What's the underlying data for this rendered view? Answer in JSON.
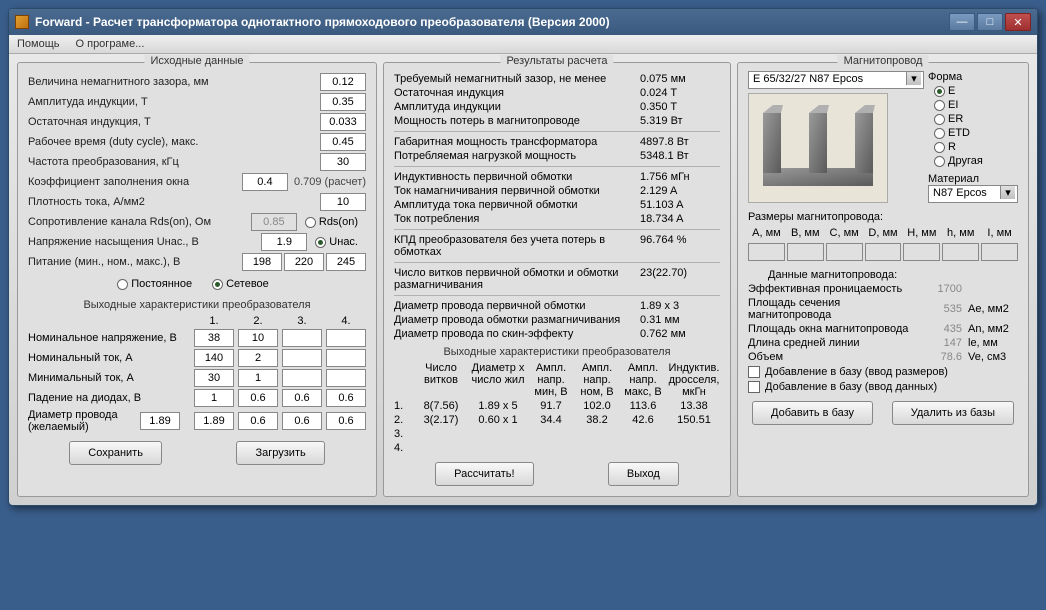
{
  "window": {
    "title": "Forward - Расчет трансформатора однотактного прямоходового преобразователя (Версия 2000)"
  },
  "menu": {
    "help": "Помощь",
    "about": "О програме..."
  },
  "panels": {
    "left": "Исходные данные",
    "mid": "Результаты расчета",
    "right": "Магнитопровод"
  },
  "inputs": {
    "gap": {
      "label": "Величина немагнитного зазора, мм",
      "value": "0.12"
    },
    "ampl": {
      "label": "Амплитуда индукции, T",
      "value": "0.35"
    },
    "resid": {
      "label": "Остаточная индукция, T",
      "value": "0.033"
    },
    "duty": {
      "label": "Рабочее время (duty cycle), макс.",
      "value": "0.45"
    },
    "freq": {
      "label": "Частота преобразования, кГц",
      "value": "30"
    },
    "fill": {
      "label": "Коэффициент заполнения окна",
      "value": "0.4",
      "calc": "0.709 (расчет)"
    },
    "jdens": {
      "label": "Плотность тока, A/мм2",
      "value": "10"
    },
    "rdson": {
      "label": "Сопротивление канала Rds(on), Ом",
      "value": "0.85",
      "radio": "Rds(on)"
    },
    "usat": {
      "label": "Напряжение насыщения Uнас., B",
      "value": "1.9",
      "radio": "Uнас."
    },
    "supply": {
      "label": "Питание (мин., ном., макс.), В",
      "v1": "198",
      "v2": "220",
      "v3": "245"
    },
    "supply_mode": {
      "dc": "Постоянное",
      "ac": "Сетевое"
    }
  },
  "out_header": "Выходные характеристики преобразователя",
  "out_cols": [
    "1.",
    "2.",
    "3.",
    "4."
  ],
  "out_rows": {
    "vnom": {
      "label": "Номинальное напряжение, В",
      "v": [
        "38",
        "10",
        "",
        ""
      ]
    },
    "inom": {
      "label": "Номинальный ток, А",
      "v": [
        "140",
        "2",
        "",
        ""
      ]
    },
    "imin": {
      "label": "Минимальный ток, А",
      "v": [
        "30",
        "1",
        "",
        ""
      ]
    },
    "vdrop": {
      "label": "Падение на диодах, В",
      "v": [
        "1",
        "0.6",
        "0.6",
        "0.6"
      ]
    },
    "dwire": {
      "label": "Диаметр провода (желаемый)",
      "pre": "1.89",
      "v": [
        "1.89",
        "0.6",
        "0.6",
        "0.6"
      ]
    }
  },
  "buttons": {
    "save": "Сохранить",
    "load": "Загрузить",
    "calc": "Рассчитать!",
    "exit": "Выход",
    "add": "Добавить в базу",
    "del": "Удалить из базы"
  },
  "results": {
    "r1": {
      "label": "Требуемый немагнитный зазор, не менее",
      "val": "0.075 мм"
    },
    "r2": {
      "label": "Остаточная индукция",
      "val": "0.024 T"
    },
    "r3": {
      "label": "Амплитуда индукции",
      "val": "0.350 T"
    },
    "r4": {
      "label": "Мощность потерь в магнитопроводе",
      "val": "5.319 Вт"
    },
    "r5": {
      "label": "Габаритная мощность трансформатора",
      "val": "4897.8 Вт"
    },
    "r6": {
      "label": "Потребляемая нагрузкой мощность",
      "val": "5348.1 Вт"
    },
    "r7": {
      "label": "Индуктивность первичной обмотки",
      "val": "1.756 мГн"
    },
    "r8": {
      "label": "Ток намагничивания первичной обмотки",
      "val": "2.129 A"
    },
    "r9": {
      "label": "Амплитуда тока первичной обмотки",
      "val": "51.103 A"
    },
    "r10": {
      "label": "Ток потребления",
      "val": "18.734 A"
    },
    "r11": {
      "label": "КПД преобразователя без учета потерь в обмотках",
      "val": "96.764 %"
    },
    "r12": {
      "label": "Число витков первичной обмотки и обмотки размагничивания",
      "val": "23(22.70)"
    },
    "r13": {
      "label": "Диаметр провода первичной обмотки",
      "val": "1.89 x 3"
    },
    "r14": {
      "label": "Диаметр провода обмотки размагничивания",
      "val": "0.31 мм"
    },
    "r15": {
      "label": "Диаметр провода по скин-эффекту",
      "val": "0.762 мм"
    }
  },
  "out_table": {
    "header": "Выходные характеристики преобразователя",
    "cols": [
      "",
      "Число витков",
      "Диаметр x число жил",
      "Ампл. напр. мин, В",
      "Ампл. напр. ном, В",
      "Ампл. напр. макс, В",
      "Индуктив. дросселя, мкГн"
    ],
    "rows": [
      [
        "1.",
        "8(7.56)",
        "1.89 x 5",
        "91.7",
        "102.0",
        "113.6",
        "13.38"
      ],
      [
        "2.",
        "3(2.17)",
        "0.60 x 1",
        "34.4",
        "38.2",
        "42.6",
        "150.51"
      ],
      [
        "3.",
        "",
        "",
        "",
        "",
        "",
        ""
      ],
      [
        "4.",
        "",
        "",
        "",
        "",
        "",
        ""
      ]
    ]
  },
  "core": {
    "select": "E 65/32/27 N87 Epcos",
    "form_label": "Форма",
    "forms": [
      "E",
      "EI",
      "ER",
      "ETD",
      "R",
      "Другая"
    ],
    "material_label": "Материал",
    "material": "N87 Epcos",
    "dims_label": "Размеры магнитопровода:",
    "dims": [
      "A, мм",
      "B, мм",
      "C, мм",
      "D, мм",
      "H, мм",
      "h, мм",
      "I, мм"
    ],
    "data_label": "Данные магнитопровода:",
    "data": {
      "perm": {
        "label": "Эффективная проницаемость",
        "val": "1700",
        "unit": ""
      },
      "ae": {
        "label": "Площадь сечения магнитопровода",
        "val": "535",
        "unit": "Ae, мм2"
      },
      "an": {
        "label": "Площадь окна магнитопровода",
        "val": "435",
        "unit": "An, мм2"
      },
      "le": {
        "label": "Длина средней линии",
        "val": "147",
        "unit": "le, мм"
      },
      "ve": {
        "label": "Объем",
        "val": "78.6",
        "unit": "Ve, см3"
      }
    },
    "chk1": "Добавление в базу (ввод размеров)",
    "chk2": "Добавление в базу (ввод данных)"
  }
}
